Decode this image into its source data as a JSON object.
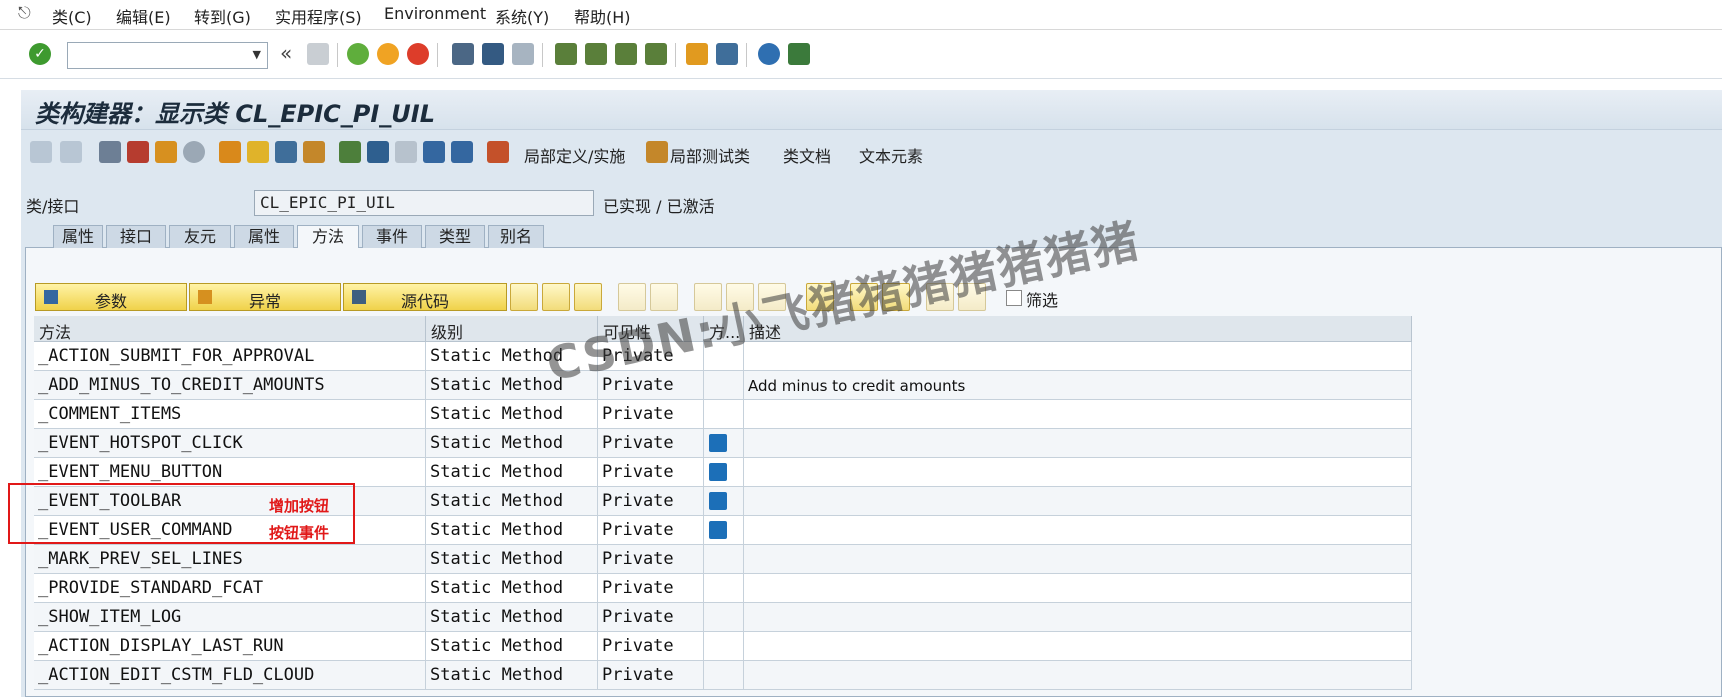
{
  "menubar": {
    "items": [
      "类(C)",
      "编辑(E)",
      "转到(G)",
      "实用程序(S)",
      "Environment",
      "系统(Y)",
      "帮助(H)"
    ]
  },
  "title": "类构建器：显示类 CL_EPIC_PI_UIL",
  "appbar": {
    "local_def": "局部定义/实施",
    "local_test": "局部测试类",
    "class_doc": "类文档",
    "text_elements": "文本元素"
  },
  "header_fields": {
    "class_label": "类/接口",
    "class_value": "CL_EPIC_PI_UIL",
    "status": "已实现 / 已激活"
  },
  "tabs": [
    "属性",
    "接口",
    "友元",
    "属性",
    "方法",
    "事件",
    "类型",
    "别名"
  ],
  "active_tab": "方法",
  "method_toolbar": {
    "params": "参数",
    "exceptions": "异常",
    "source": "源代码",
    "filter": "筛选"
  },
  "grid": {
    "columns": [
      "方法",
      "级别",
      "可见性",
      "方...",
      "描述"
    ],
    "rows": [
      {
        "name": "_ACTION_SUBMIT_FOR_APPROVAL",
        "level": "Static Method",
        "visibility": "Private",
        "event": false,
        "desc": ""
      },
      {
        "name": "_ADD_MINUS_TO_CREDIT_AMOUNTS",
        "level": "Static Method",
        "visibility": "Private",
        "event": false,
        "desc": "Add minus to credit amounts"
      },
      {
        "name": "_COMMENT_ITEMS",
        "level": "Static Method",
        "visibility": "Private",
        "event": false,
        "desc": ""
      },
      {
        "name": "_EVENT_HOTSPOT_CLICK",
        "level": "Static Method",
        "visibility": "Private",
        "event": true,
        "desc": ""
      },
      {
        "name": "_EVENT_MENU_BUTTON",
        "level": "Static Method",
        "visibility": "Private",
        "event": true,
        "desc": ""
      },
      {
        "name": "_EVENT_TOOLBAR",
        "level": "Static Method",
        "visibility": "Private",
        "event": true,
        "desc": ""
      },
      {
        "name": "_EVENT_USER_COMMAND",
        "level": "Static Method",
        "visibility": "Private",
        "event": true,
        "desc": ""
      },
      {
        "name": "_MARK_PREV_SEL_LINES",
        "level": "Static Method",
        "visibility": "Private",
        "event": false,
        "desc": ""
      },
      {
        "name": "_PROVIDE_STANDARD_FCAT",
        "level": "Static Method",
        "visibility": "Private",
        "event": false,
        "desc": ""
      },
      {
        "name": "_SHOW_ITEM_LOG",
        "level": "Static Method",
        "visibility": "Private",
        "event": false,
        "desc": ""
      },
      {
        "name": "_ACTION_DISPLAY_LAST_RUN",
        "level": "Static Method",
        "visibility": "Private",
        "event": false,
        "desc": ""
      },
      {
        "name": "_ACTION_EDIT_CSTM_FLD_CLOUD",
        "level": "Static Method",
        "visibility": "Private",
        "event": false,
        "desc": ""
      }
    ]
  },
  "annotations": {
    "toolbar_note": "增加按钮",
    "command_note": "按钮事件"
  },
  "watermark": "CSDN:小飞猪猪猪猪猪猪猪",
  "colors": {
    "accent_green": "#3e9a2f",
    "annotation_red": "#e11818",
    "button_yellow": "#f0d24a",
    "event_blue": "#1c6fb8"
  }
}
